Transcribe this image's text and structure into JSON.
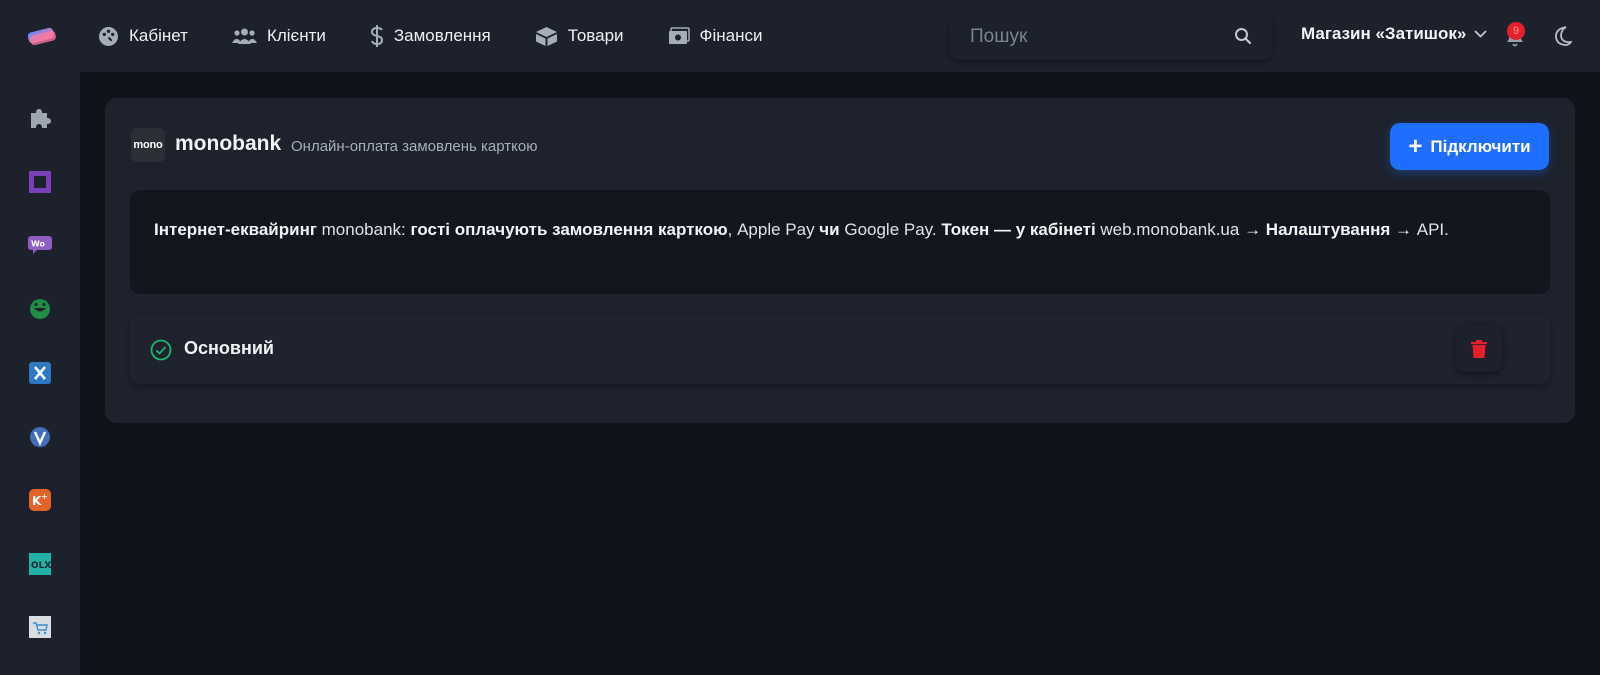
{
  "nav": {
    "items": [
      {
        "id": "cabinet",
        "label": "Кабінет",
        "icon": "palette-icon"
      },
      {
        "id": "clients",
        "label": "Клієнти",
        "icon": "users-icon"
      },
      {
        "id": "orders",
        "label": "Замовлення",
        "icon": "dollar-icon"
      },
      {
        "id": "products",
        "label": "Товари",
        "icon": "box-icon"
      },
      {
        "id": "finance",
        "label": "Фінанси",
        "icon": "money-icon"
      }
    ]
  },
  "search": {
    "placeholder": "Пошук"
  },
  "store": {
    "name": "Магазин «Затишок»"
  },
  "notifications": {
    "count": "9"
  },
  "sidebar": {
    "items": [
      "puzzle-icon",
      "square-icon",
      "woocommerce-icon",
      "happy-face-icon",
      "x-icon",
      "shield-icon",
      "k-plus-icon",
      "olx-icon",
      "cart-icon"
    ]
  },
  "integration": {
    "logo_text": "mono",
    "name": "monobank",
    "subtitle": "Онлайн-оплата замовлень карткою",
    "connect_label": "Підключити",
    "info": {
      "p1": "Інтернет-еквайринг",
      "p2": " monobank: ",
      "p3": "гості оплачують замовлення карткою",
      "p4": ", Apple Pay ",
      "p5": "чи",
      "p6": " Google Pay. ",
      "p7": "Токен — у кабінеті",
      "p8": " web.monobank.ua ",
      "p9": "→ Налаштування →",
      "p10": " API."
    },
    "account_label": "Основний"
  },
  "colors": {
    "accent": "#1f6fff",
    "success": "#22b573",
    "danger": "#e3202b"
  }
}
